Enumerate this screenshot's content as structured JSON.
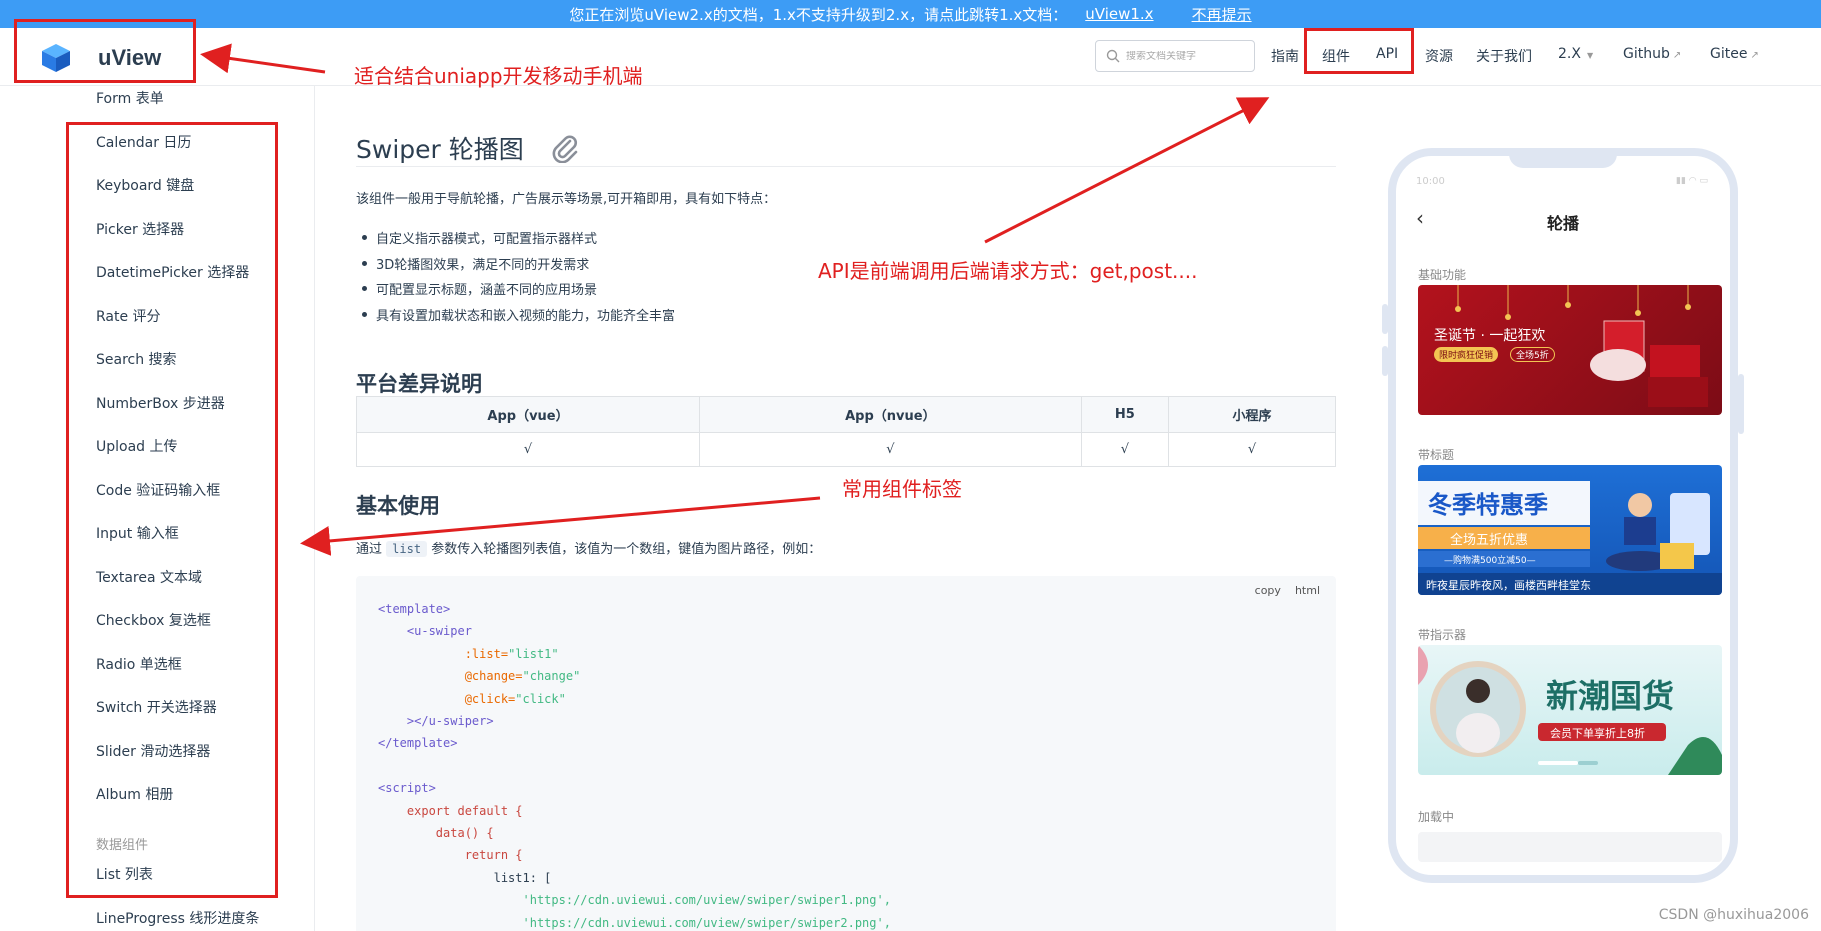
{
  "banner": {
    "text": "您正在浏览uView2.x的文档，1.x不支持升级到2.x，请点此跳转1.x文档：",
    "link": "uView1.x",
    "dismiss": "不再提示"
  },
  "header": {
    "logo_text": "uView",
    "search_placeholder": "搜索文档关键字",
    "nav": {
      "guide": "指南",
      "components": "组件",
      "api": "API",
      "resources": "资源",
      "about": "关于我们",
      "version": "2.X",
      "github": "Github",
      "gitee": "Gitee"
    }
  },
  "sidebar": {
    "items": [
      "Form 表单",
      "Calendar 日历",
      "Keyboard 键盘",
      "Picker 选择器",
      "DatetimePicker 选择器",
      "Rate 评分",
      "Search 搜索",
      "NumberBox 步进器",
      "Upload 上传",
      "Code 验证码输入框",
      "Input 输入框",
      "Textarea 文本域",
      "Checkbox 复选框",
      "Radio 单选框",
      "Switch 开关选择器",
      "Slider 滑动选择器",
      "Album 相册",
      "List 列表",
      "LineProgress 线形进度条"
    ],
    "group_label": "数据组件"
  },
  "main": {
    "title": "Swiper 轮播图",
    "intro": "该组件一般用于导航轮播，广告展示等场景,可开箱即用，具有如下特点：",
    "features": [
      "自定义指示器模式，可配置指示器样式",
      "3D轮播图效果，满足不同的开发需求",
      "可配置显示标题，涵盖不同的应用场景",
      "具有设置加载状态和嵌入视频的能力，功能齐全丰富"
    ],
    "platform_heading": "平台差异说明",
    "table": {
      "headers": [
        "App（vue）",
        "App（nvue）",
        "H5",
        "小程序"
      ],
      "row": [
        "√",
        "√",
        "√",
        "√"
      ]
    },
    "usage_heading": "基本使用",
    "usage_prefix": "通过",
    "usage_code": "list",
    "usage_suffix": "参数传入轮播图列表值，该值为一个数组，键值为图片路径，例如：",
    "code_copy": "copy",
    "code_lang": "html",
    "code": {
      "l1": "<template>",
      "l2": "<u-swiper",
      "l3_attr": ":list=",
      "l3_val": "\"list1\"",
      "l4_attr": "@change=",
      "l4_val": "\"change\"",
      "l5_attr": "@click=",
      "l5_val": "\"click\"",
      "l6": "></u-swiper>",
      "l7": "</template>",
      "l9": "<script>",
      "l10": "export default {",
      "l11": "data() {",
      "l12": "return {",
      "l13": "list1: [",
      "l14": "'https://cdn.uviewui.com/uview/swiper/swiper1.png',",
      "l15": "'https://cdn.uviewui.com/uview/swiper/swiper2.png',"
    }
  },
  "phone": {
    "time": "10:00",
    "title": "轮播",
    "sections": [
      "基础功能",
      "带标题",
      "带指示器",
      "加载中"
    ],
    "slide1_text": "圣诞节 · 一起狂欢",
    "slide1_tag": "限时疯狂促销",
    "slide1_tag2": "全场5折",
    "slide2_text": "冬季特惠季",
    "slide2_sub": "全场五折优惠",
    "slide2_note": "—购物满500立减50—",
    "slide2_caption": "昨夜星辰昨夜风，画楼西畔桂堂东",
    "slide3_text": "新潮国货",
    "slide3_sub": "会员下单享折上8折"
  },
  "annotations": {
    "a1": "适合结合uniapp开发移动手机端",
    "a2": "API是前端调用后端请求方式：get,post....",
    "a3": "常用组件标签"
  },
  "watermark": "CSDN @huxihua2006",
  "colors": {
    "banner": "#3d9cf5",
    "annotation": "#e02020",
    "accent": "#3c9cff"
  }
}
